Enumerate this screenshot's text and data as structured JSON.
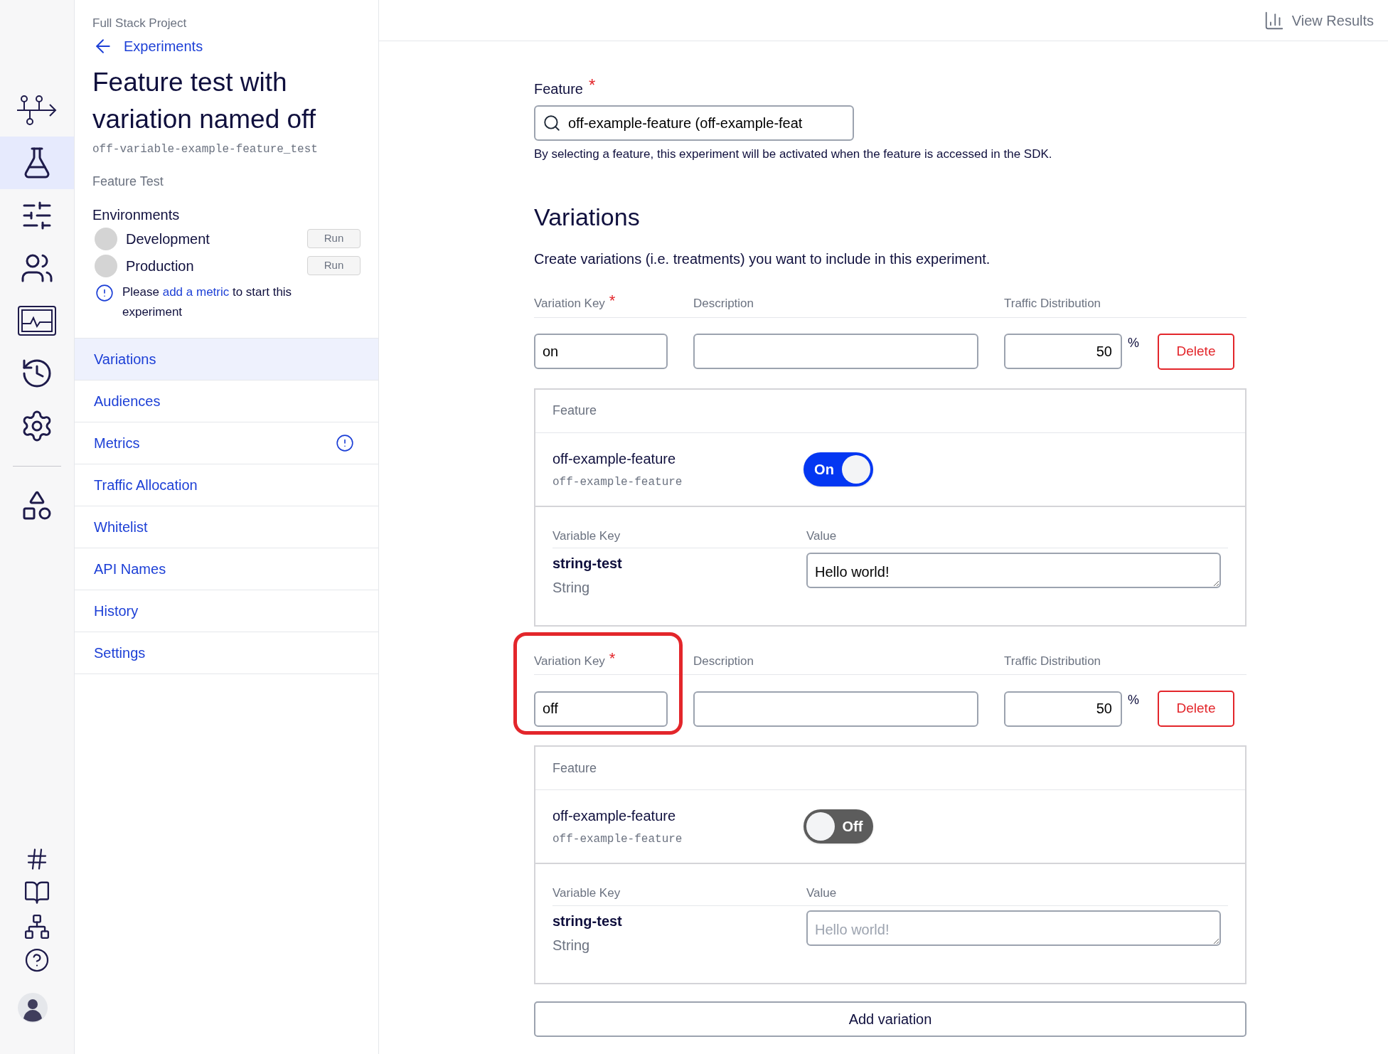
{
  "rail": {
    "items": [
      {
        "kind": "flow",
        "selected": false
      },
      {
        "kind": "flask",
        "selected": true
      },
      {
        "kind": "sliders",
        "selected": false
      },
      {
        "kind": "users",
        "selected": false
      },
      {
        "kind": "monitor",
        "selected": false
      },
      {
        "kind": "history",
        "selected": false
      },
      {
        "kind": "settings",
        "selected": false
      }
    ],
    "tools": [
      {
        "kind": "shapes",
        "selected": false
      }
    ],
    "bottom": [
      {
        "kind": "hash"
      },
      {
        "kind": "book"
      },
      {
        "kind": "network"
      },
      {
        "kind": "help"
      },
      {
        "kind": "avatar"
      }
    ]
  },
  "sidebar": {
    "project": "Full Stack Project",
    "back_link": "Experiments",
    "title": "Feature test with variation named off",
    "key": "off-variable-example-feature_test",
    "type": "Feature Test",
    "environments_heading": "Environments",
    "environments": [
      {
        "name": "Development",
        "button": "Run"
      },
      {
        "name": "Production",
        "button": "Run"
      }
    ],
    "notice": {
      "before": "Please ",
      "link": "add a metric",
      "after": " to start this experiment"
    },
    "nav": [
      {
        "label": "Variations",
        "selected": true,
        "warning": false
      },
      {
        "label": "Audiences",
        "selected": false,
        "warning": false
      },
      {
        "label": "Metrics",
        "selected": false,
        "warning": true
      },
      {
        "label": "Traffic Allocation",
        "selected": false,
        "warning": false
      },
      {
        "label": "Whitelist",
        "selected": false,
        "warning": false
      },
      {
        "label": "API Names",
        "selected": false,
        "warning": false
      },
      {
        "label": "History",
        "selected": false,
        "warning": false
      },
      {
        "label": "Settings",
        "selected": false,
        "warning": false
      }
    ]
  },
  "topbar": {
    "view_results": "View Results"
  },
  "feature": {
    "label": "Feature",
    "required": "*",
    "value": "off-example-feature (off-example-feat",
    "help": "By selecting a feature, this experiment will be activated when the feature is accessed in the SDK."
  },
  "variations_section": {
    "title": "Variations",
    "description": "Create variations (i.e. treatments) you want to include in this experiment."
  },
  "variations": [
    {
      "key_label": "Variation Key",
      "required": "*",
      "description_label": "Description",
      "traffic_label": "Traffic Distribution",
      "key": "on",
      "traffic": "50",
      "percent": "%",
      "delete": "Delete",
      "highlighted": false,
      "feature_heading": "Feature",
      "feature_name": "off-example-feature",
      "feature_key": "off-example-feature",
      "toggle": {
        "on": true,
        "label": "On"
      },
      "variable_key_label": "Variable Key",
      "value_label": "Value",
      "variables": [
        {
          "key": "string-test",
          "type": "String",
          "value": "Hello world!"
        }
      ]
    },
    {
      "key_label": "Variation Key",
      "required": "*",
      "description_label": "Description",
      "traffic_label": "Traffic Distribution",
      "key": "off",
      "traffic": "50",
      "percent": "%",
      "delete": "Delete",
      "highlighted": true,
      "feature_heading": "Feature",
      "feature_name": "off-example-feature",
      "feature_key": "off-example-feature",
      "toggle": {
        "on": false,
        "label": "Off"
      },
      "variable_key_label": "Variable Key",
      "value_label": "Value",
      "variables": [
        {
          "key": "string-test",
          "type": "String",
          "placeholder": "Hello world!"
        }
      ]
    }
  ],
  "add_variation": "Add variation"
}
